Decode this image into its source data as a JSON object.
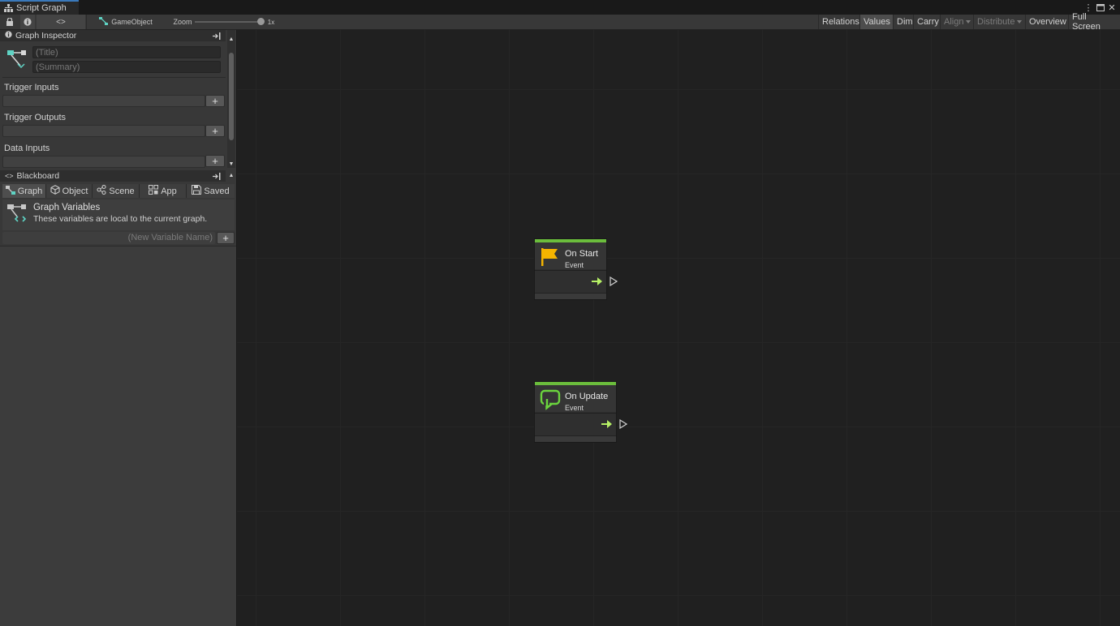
{
  "window": {
    "tab_title": "Script Graph",
    "controls": {
      "more": "⋮",
      "maximize": "□",
      "close": "✕"
    }
  },
  "toolbar": {
    "lock_icon": "lock-icon",
    "info_icon": "info-icon",
    "breadcrumb_symbol": "<⁠>",
    "gameobject_label": "GameObject",
    "zoom_label": "Zoom",
    "zoom_value": "1x",
    "zoom_level": 1,
    "right_buttons": [
      {
        "label": "Relations",
        "state": "normal"
      },
      {
        "label": "Values",
        "state": "active"
      },
      {
        "label": "Dim",
        "state": "normal"
      },
      {
        "label": "Carry",
        "state": "normal"
      },
      {
        "label": "Align",
        "state": "disabled",
        "dropdown": true
      },
      {
        "label": "Distribute",
        "state": "disabled",
        "dropdown": true
      },
      {
        "label": "Overview",
        "state": "normal"
      },
      {
        "label": "Full Screen",
        "state": "normal"
      }
    ]
  },
  "inspector": {
    "header": "Graph Inspector",
    "title_placeholder": "(Title)",
    "summary_placeholder": "(Summary)",
    "sections": [
      "Trigger Inputs",
      "Trigger Outputs",
      "Data Inputs"
    ],
    "add_symbol": "+"
  },
  "blackboard": {
    "header": "Blackboard",
    "tabs": [
      "Graph",
      "Object",
      "Scene",
      "App",
      "Saved"
    ],
    "active_tab": "Graph",
    "variables_title": "Graph Variables",
    "variables_desc": "These variables are local to the current graph.",
    "new_variable_placeholder": "(New Variable Name)",
    "add_symbol": "+"
  },
  "nodes": [
    {
      "title": "On Start",
      "subtitle": "Event",
      "icon": "flag-icon"
    },
    {
      "title": "On Update",
      "subtitle": "Event",
      "icon": "loop-icon"
    }
  ],
  "colors": {
    "accent_blue": "#3a79bb",
    "event_green": "#6bbd3c",
    "flag_yellow": "#f4b400",
    "teal_icon": "#5fd3c4",
    "flow_arrow": "#b6f065"
  }
}
